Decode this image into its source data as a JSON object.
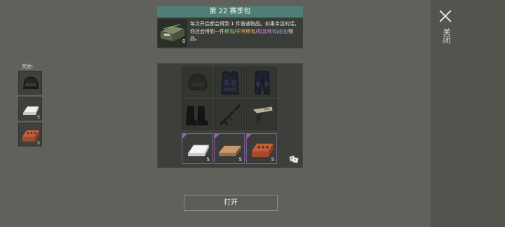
{
  "close": {
    "label": "关闭",
    "icon": "close-icon"
  },
  "rewards": {
    "label": "奖励:",
    "items": [
      {
        "name": "helmet",
        "qty": ""
      },
      {
        "name": "silver-ingot",
        "qty": "5"
      },
      {
        "name": "brick",
        "qty": "5"
      }
    ]
  },
  "header": {
    "title": "第 22 赛季包",
    "pack_qty": "0",
    "desc_1": "每次开启都会得到 1 件普通物品。如果幸运的话，你还会得到一件",
    "desc_rare": "稀有",
    "desc_sep1": "/",
    "desc_vrare": "非常稀有",
    "desc_sep2": "/",
    "desc_ultra": "极其稀有",
    "desc_sep3": "/",
    "desc_sure": "必出",
    "desc_end": "物品。"
  },
  "grid": {
    "items": [
      {
        "name": "helmet",
        "icon": "helmet-icon"
      },
      {
        "name": "body-armor",
        "icon": "vest-icon"
      },
      {
        "name": "armored-pants",
        "icon": "pants-icon"
      },
      {
        "name": "boots",
        "icon": "boots-icon"
      },
      {
        "name": "assault-rifle",
        "icon": "rifle-icon"
      },
      {
        "name": "pistol",
        "icon": "pistol-icon"
      }
    ],
    "bonus": [
      {
        "name": "silver-ingot",
        "qty": "5"
      },
      {
        "name": "wood-plank",
        "qty": "5"
      },
      {
        "name": "brick",
        "qty": "5"
      }
    ]
  },
  "open_button": {
    "label": "打开"
  },
  "colors": {
    "background": "#5f615a",
    "header_bar": "#4e7f77",
    "rare": "#86d36a",
    "very_rare": "#e7b35a",
    "ultra_rare": "#c47ae0",
    "guaranteed": "#7fc7d9",
    "bonus_border": "#7d5b93"
  }
}
